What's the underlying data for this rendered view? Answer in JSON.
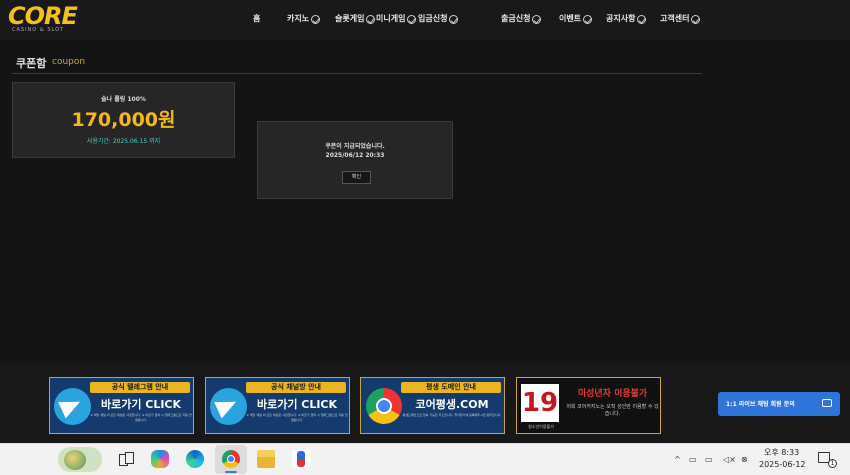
{
  "header": {
    "logo_main": "CORE",
    "logo_sub": "CASINO & SLOT",
    "nav": [
      {
        "label": "홈"
      },
      {
        "label": "카지노"
      },
      {
        "label": "슬롯게임"
      },
      {
        "label": "미니게임"
      },
      {
        "label": "입금신청"
      },
      {
        "label": "출금신청"
      },
      {
        "label": "이벤트"
      },
      {
        "label": "공지사항"
      },
      {
        "label": "고객센터"
      }
    ]
  },
  "section": {
    "title": "쿠폰함",
    "subtitle": "coupon"
  },
  "coupon": {
    "name": "슬나 롤링 100%",
    "amount": "170,000원",
    "period": "사용기간: 2025.06.15 까지"
  },
  "dialog": {
    "message": "쿠폰이 지급되었습니다.",
    "time": "2025/06/12 20:33",
    "confirm_label": "확인"
  },
  "banners": [
    {
      "label": "공식 텔레그램 안내",
      "main": "바로가기 CLICK",
      "desc": "※ 해당 채널 외 모든 채널은 사칭입니다. ※ 바로가 클릭 시 텔레그램으로 자동 연결됩니다.",
      "icon": "telegram-icon"
    },
    {
      "label": "공식 채널방 안내",
      "main": "바로가기 CLICK",
      "desc": "※ 해당 채널 외 모든 채널은 사칭입니다. ※ 바로가 클릭 시 텔레그램으로 자동 연결됩니다.",
      "icon": "telegram-icon"
    },
    {
      "label": "평생 도메인 안내",
      "main": "코어평생.COM",
      "desc": "평생도메인으로 접속 가능한 주소입니다. 즐겨찾기에 등록해두시면 편리합니다.",
      "icon": "chrome-icon"
    },
    {
      "age": "19",
      "age_label": "청소년이용불가",
      "main": "미성년자 이용불가",
      "desc": "저희 코어카지노는 오직 성인만 이용할 수 있습니다."
    }
  ],
  "chat": {
    "label": "1:1 라이브 채팅 회원 문의"
  },
  "taskbar": {
    "clock_time": "오후 8:33",
    "clock_date": "2025-06-12",
    "notification_count": "1",
    "tray_caret": "^"
  },
  "colors": {
    "accent_gold": "#f5b817",
    "accent_teal": "#4bd0c6",
    "chat_blue": "#2f74d8"
  }
}
